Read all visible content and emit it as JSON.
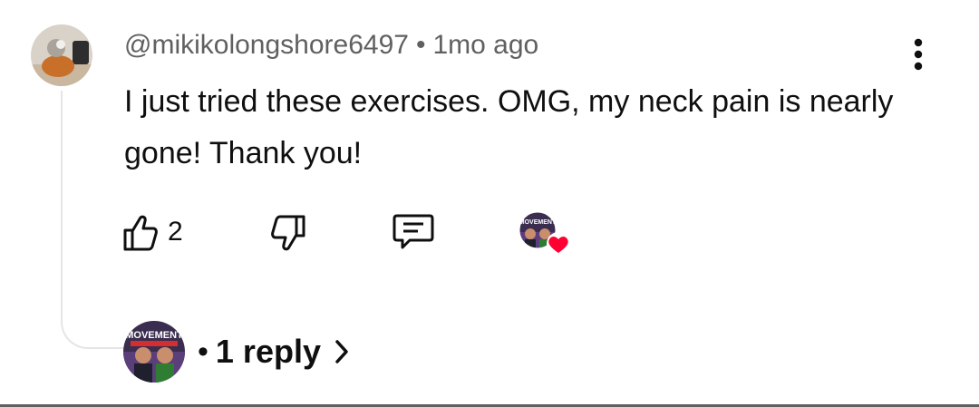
{
  "comment": {
    "author": "@mikikolongshore6497",
    "separator": "•",
    "time": "1mo ago",
    "text": "I just tried these exercises. OMG, my neck pain is nearly gone! Thank you!",
    "like_count": "2"
  },
  "creator_badge": {
    "channel_text": "MOVEMENT",
    "heart_color": "#ff0033"
  },
  "replies": {
    "separator": "•",
    "label": "1 reply",
    "channel_text": "MOVEMENT"
  },
  "icons": [
    "avatar",
    "more-vert-icon",
    "thumbs-up-icon",
    "thumbs-down-icon",
    "reply-comment-icon",
    "heart-icon",
    "chevron-right-icon"
  ]
}
